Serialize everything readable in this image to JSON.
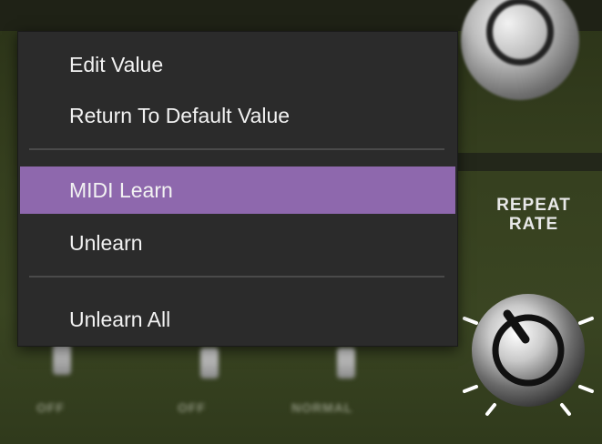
{
  "panel": {
    "repeat_label_line1": "REPEAT",
    "repeat_label_line2": "RATE",
    "switch_labels": [
      "OFF",
      "OFF",
      "NORMAL"
    ]
  },
  "context_menu": {
    "items": [
      {
        "label": "Edit Value"
      },
      {
        "label": "Return To Default Value"
      },
      {
        "label": "MIDI Learn",
        "selected": true
      },
      {
        "label": "Unlearn"
      },
      {
        "label": "Unlearn All"
      }
    ],
    "highlight_color": "#8e68ad"
  },
  "icons": {
    "knob_main": "rotary-knob-icon",
    "knob_top": "rotary-knob-icon"
  }
}
